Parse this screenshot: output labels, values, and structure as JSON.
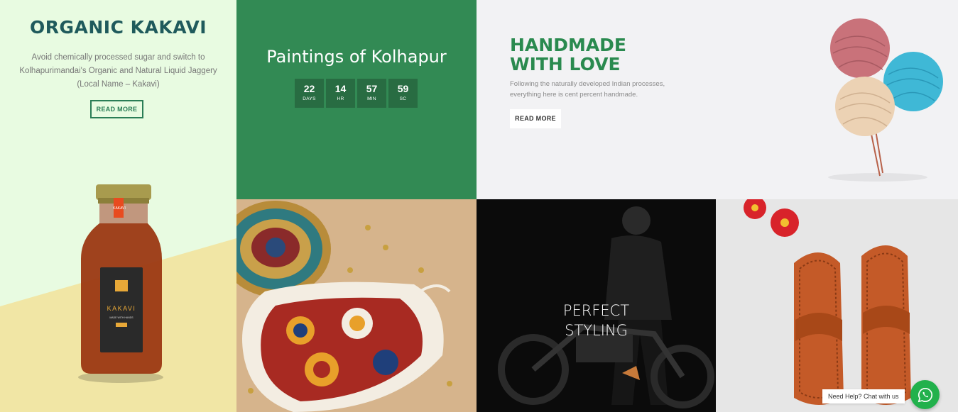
{
  "kakavi": {
    "title": "ORGANIC KAKAVI",
    "description": "Avoid chemically processed sugar and switch to Kolhapurimandai's Organic and Natural Liquid Jaggery (Local Name – Kakavi)",
    "button_label": "READ MORE",
    "bottle_label": "KAKAVI",
    "bottle_subtitle": "MADE WITH HANDS",
    "bottle_tag": "KAKAVI"
  },
  "paintings": {
    "title": "Paintings of Kolhapur",
    "countdown": [
      {
        "value": "22",
        "unit": "DAYS"
      },
      {
        "value": "14",
        "unit": "HR"
      },
      {
        "value": "57",
        "unit": "MIN"
      },
      {
        "value": "59",
        "unit": "SC"
      }
    ]
  },
  "handmade": {
    "title_line1": "HANDMADE",
    "title_line2": "WITH LOVE",
    "description": "Following the naturally developed Indian processes, everything here is cent percent handmade.",
    "button_label": "READ MORE"
  },
  "styling": {
    "title_line1": "PERFECT",
    "title_line2": "STYLING"
  },
  "chat": {
    "help_text": "Need Help? Chat with us"
  },
  "colors": {
    "green_dark": "#328a54",
    "teal_title": "#1f5a5c",
    "handmade_green": "#2a8a4f",
    "whatsapp": "#22b14c"
  }
}
